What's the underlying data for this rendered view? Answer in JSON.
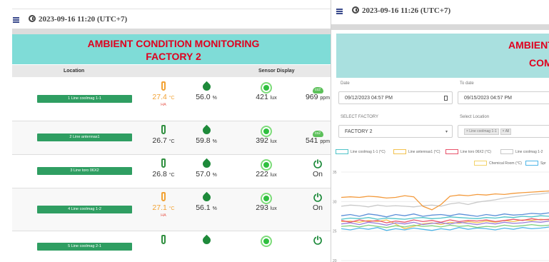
{
  "left_panel": {
    "timestamp": "2023-09-16 11:20 (UTC+7)",
    "banner_line1": "AMBIENT CONDITION MONITORING",
    "banner_line2": "FACTORY 2",
    "col_location": "Location",
    "col_sensor": "Sensor Display",
    "rows": [
      {
        "location": "1 Line coolmag 1-1",
        "temp": "27.4",
        "temp_unit": "°C",
        "temp_alert": "HA",
        "humidity": "56.0",
        "hum_unit": "%",
        "lux": "421",
        "lux_unit": "lux",
        "last_value": "969",
        "last_unit": "ppm",
        "last_type": "co2",
        "alert": true
      },
      {
        "location": "2 Line antennas1",
        "temp": "26.7",
        "temp_unit": "°C",
        "temp_alert": "",
        "humidity": "59.8",
        "hum_unit": "%",
        "lux": "392",
        "lux_unit": "lux",
        "last_value": "541",
        "last_unit": "ppm",
        "last_type": "co2",
        "alert": false
      },
      {
        "location": "3 Line toro 06X2",
        "temp": "26.8",
        "temp_unit": "°C",
        "temp_alert": "",
        "humidity": "57.0",
        "hum_unit": "%",
        "lux": "222",
        "lux_unit": "lux",
        "last_value": "On",
        "last_unit": "",
        "last_type": "power",
        "alert": false
      },
      {
        "location": "4 Line coolmag 1-2",
        "temp": "27.1",
        "temp_unit": "°C",
        "temp_alert": "HA",
        "humidity": "56.1",
        "hum_unit": "%",
        "lux": "293",
        "lux_unit": "lux",
        "last_value": "On",
        "last_unit": "",
        "last_type": "power",
        "alert": true
      },
      {
        "location": "5 Line coolmag 2-1",
        "temp": "",
        "temp_unit": "",
        "temp_alert": "",
        "humidity": "",
        "hum_unit": "",
        "lux": "",
        "lux_unit": "",
        "last_value": "",
        "last_unit": "",
        "last_type": "power",
        "alert": false
      }
    ]
  },
  "right_panel": {
    "timestamp": "2023-09-16 11:26 (UTC+7)",
    "banner_line1": "AMBIENT C",
    "banner_line2": "COM",
    "date_label": "Date",
    "date_value": "09/12/2023 04:57 PM",
    "todate_label": "To date",
    "todate_value": "09/15/2023 04:57 PM",
    "factory_label": "SELECT FACTORY",
    "factory_value": "FACTORY 2",
    "location_label": "Select Location",
    "location_chips": [
      "× Line coolmag 1-1",
      "× All"
    ],
    "legend": [
      {
        "name": "Line coolmag 1-1 (°C)",
        "color": "#4fc3c8"
      },
      {
        "name": "Line antennas1 (°C)",
        "color": "#f3c24f"
      },
      {
        "name": "Line toro 06X2 (°C)",
        "color": "#e8536b"
      },
      {
        "name": "Line  coolmag 1-2",
        "color": "#c8c8c8"
      },
      {
        "name": "Chemical Room (°C)",
        "color": "#f3d36b"
      },
      {
        "name": "Spr",
        "color": "#4fb6e8"
      }
    ],
    "y_ticks": [
      "35",
      "30",
      "25",
      "20"
    ]
  },
  "chart_data": {
    "type": "line",
    "ylim": [
      20,
      35
    ],
    "y_ticks": [
      35,
      30,
      25,
      20
    ],
    "series": [
      {
        "name": "Line coolmag 1-1 (°C)",
        "color": "#4fc3c8",
        "values": [
          27,
          27.2,
          27.1,
          27.3,
          27,
          27.2,
          27.1,
          27,
          27.2,
          27.3,
          27.1,
          27.2,
          27.4,
          27.3,
          27.2,
          27.1,
          27.3,
          27.2,
          27.4,
          27.3,
          27.5,
          27.4,
          27.6,
          27.5
        ]
      },
      {
        "name": "Line antennas1 (°C)",
        "color": "#f3c24f",
        "values": [
          26.6,
          26.7,
          26.5,
          26.8,
          26.6,
          26.9,
          26.2,
          25.4,
          25.8,
          26.2,
          26.4,
          26.1,
          26.5,
          26.3,
          26.6,
          26.4,
          26.7,
          26.5,
          26.8,
          26.6,
          26.9,
          26.8,
          27,
          26.9
        ]
      },
      {
        "name": "Line toro 06X2 (°C)",
        "color": "#e8536b",
        "values": [
          26.8,
          26.5,
          26.9,
          26.6,
          26.8,
          26.4,
          26.7,
          26.5,
          26.9,
          26.6,
          26.8,
          26.5,
          26.9,
          26.6,
          26.8,
          26.7,
          26.9,
          26.6,
          26.8,
          27,
          26.8,
          27.1,
          26.9,
          27
        ]
      },
      {
        "name": "Line  coolmag 1-2",
        "color": "#c8c8c8",
        "values": [
          29.2,
          29.4,
          29.3,
          29.1,
          29.4,
          29.2,
          29.3,
          29.2,
          29.1,
          29.3,
          29.4,
          29.2,
          29.6,
          29.8,
          29.5,
          29.9,
          30.1,
          30.3,
          30.6,
          30.8,
          31,
          31.2,
          31.3,
          31.5
        ]
      },
      {
        "name": "Chemical Room (°C)",
        "color": "#f39a3c",
        "values": [
          30.7,
          30.8,
          30.7,
          30.9,
          30.8,
          30.6,
          30.7,
          31,
          30.8,
          29.2,
          28.6,
          29.5,
          30.9,
          31.1,
          31,
          31.2,
          31.1,
          31.3,
          31.2,
          31.4,
          31.5,
          31.6,
          31.7,
          31.8
        ]
      },
      {
        "name": "Spr",
        "color": "#4fb6e8",
        "values": [
          25.4,
          25.2,
          25.5,
          25.3,
          25.6,
          25.1,
          25.4,
          25.2,
          25.5,
          25.3,
          25.1,
          25.4,
          25.2,
          25.6,
          25.3,
          25.5,
          25.4,
          25.2,
          25.5,
          25.3,
          25.6,
          25.4,
          25.5,
          25.7
        ]
      },
      {
        "name": "",
        "color": "#5b8fd8",
        "values": [
          27.6,
          27.8,
          27.5,
          27.9,
          27.7,
          27.4,
          27.8,
          27.6,
          27.9,
          27.5,
          27.7,
          27.8,
          27.6,
          27.9,
          27.7,
          27.5,
          27.8,
          27.6,
          27.9,
          27.7,
          27.8,
          28,
          27.9,
          28.1
        ]
      },
      {
        "name": "",
        "color": "#9b7fd8",
        "values": [
          26.2,
          26.4,
          26.1,
          26.5,
          26.3,
          26,
          26.4,
          26.2,
          26.5,
          26.1,
          26.3,
          26.4,
          26.2,
          26.5,
          26.3,
          26.1,
          26.4,
          26.2,
          26.5,
          26.3,
          26.4,
          26.6,
          26.5,
          26.7
        ]
      },
      {
        "name": "",
        "color": "#7fcf7f",
        "values": [
          25.8,
          25.9,
          25.7,
          26,
          25.8,
          25.6,
          25.9,
          25.7,
          26,
          25.8,
          25.9,
          25.7,
          26,
          25.8,
          25.9,
          25.6,
          25.8,
          25.7,
          26,
          25.8,
          25.9,
          26.1,
          25.9,
          26
        ]
      }
    ]
  }
}
